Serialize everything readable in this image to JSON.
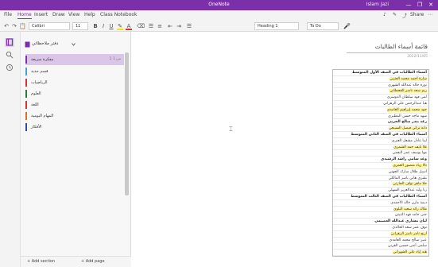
{
  "titlebar": {
    "title": "OneNote",
    "user": "Islam Jazi",
    "controls": [
      "—",
      "❐",
      "✕"
    ]
  },
  "menu": {
    "tabs": [
      "File",
      "Home",
      "Insert",
      "Draw",
      "View",
      "Help",
      "Class Notebook"
    ],
    "active_index": 1,
    "right_icons": [
      "♪",
      "✎",
      "⤴",
      "Share",
      "⋯"
    ]
  },
  "ribbon": {
    "undo": "↶",
    "redo": "↷",
    "clipboard": "📋",
    "font_name": "Calibri",
    "font_size": "11",
    "bold": "B",
    "italic": "I",
    "underline": "U",
    "highlight": "✎",
    "font_color": "A",
    "eraser": "⌫",
    "bullets": "☰",
    "numbering": "≡",
    "outdent": "⇤",
    "indent": "⇥",
    "align": "☰",
    "style_value": "Heading 1",
    "tag_value": "To Do",
    "dictate": "🎤",
    "colors": {
      "highlight": "#f4e500",
      "font": "#d13438",
      "accent": "#7b2fa8"
    }
  },
  "nav": {
    "icons": [
      "notebooks-icon",
      "search-icon",
      "recent-icon"
    ]
  },
  "notebook": {
    "name": "دفتر ملاحظاتي",
    "sections": [
      {
        "label": "مفكرة سريعة",
        "count": "1 من 1",
        "color": "#7b2fa8"
      },
      {
        "label": "قسم جديد",
        "count": "",
        "color": "#4a9fd5"
      },
      {
        "label": "الرياضيات",
        "count": "",
        "color": "#d13438"
      },
      {
        "label": "العلوم",
        "count": "",
        "color": "#2a7a3b"
      },
      {
        "label": "اللغة",
        "count": "",
        "color": "#d13438"
      },
      {
        "label": "المهام اليومية",
        "count": "",
        "color": "#e06c2a"
      },
      {
        "label": "الأفكار",
        "count": "",
        "color": "#2f4f9e"
      }
    ],
    "footer": {
      "add_section": "+ Add section",
      "add_page": "+ Add page"
    }
  },
  "page": {
    "title": "قائمة أسماء الطالبات",
    "date": "2022/11/05",
    "items": [
      {
        "text": "أسماء الطالبات في الصف الأول المتوسط",
        "style": "strong"
      },
      {
        "text": "سارة أحمد محمد العتيبي",
        "style": "hl"
      },
      {
        "text": "نورة خالد عبدالله الشهري",
        "style": ""
      },
      {
        "text": "ريم سعد ناصر القحطاني",
        "style": "hl"
      },
      {
        "text": "لمى فهد سلطان الدوسري",
        "style": ""
      },
      {
        "text": "هيا عبدالرحمن علي الزهراني",
        "style": ""
      },
      {
        "text": "جود محمد إبراهيم الغامدي",
        "style": "hl"
      },
      {
        "text": "شهد ماجد حسن المطيري",
        "style": ""
      },
      {
        "text": "رغد بندر صالح الحربي",
        "style": "strong"
      },
      {
        "text": "دانة تركي فيصل السبيعي",
        "style": "hl"
      },
      {
        "text": "أسماء الطالبات في الصف الثاني المتوسط",
        "style": "strong"
      },
      {
        "text": "لينا عادل مشعل العنزي",
        "style": ""
      },
      {
        "text": "غلا نايف حمد الشمري",
        "style": "hl"
      },
      {
        "text": "مها يوسف عمر البقمي",
        "style": ""
      },
      {
        "text": "وعد سامي راشد الرشيدي",
        "style": "strong"
      },
      {
        "text": "تالا زياد منصور العمري",
        "style": "hl"
      },
      {
        "text": "أسيل طلال مبارك الجهني",
        "style": ""
      },
      {
        "text": "بشرى هاني ياسر المالكي",
        "style": ""
      },
      {
        "text": "حلا ماهر نواف الحارثي",
        "style": "hl"
      },
      {
        "text": "رنا وليد عبدالعزيز السهلي",
        "style": ""
      },
      {
        "text": "أسماء الطالبات في الصف الثالث المتوسط",
        "style": "strong"
      },
      {
        "text": "ديمة مازن خالد الأحمدي",
        "style": ""
      },
      {
        "text": "ملاك رائد سعيد البلوي",
        "style": "hl"
      },
      {
        "text": "جنى حامد فهد الثبيتي",
        "style": ""
      },
      {
        "text": "ليان مشاري عبدالله العصيمي",
        "style": "strong"
      },
      {
        "text": "نوف عمر سعد الخالدي",
        "style": ""
      },
      {
        "text": "أريج ثامر ناصر الزهراني",
        "style": "hl"
      },
      {
        "text": "عبير صالح محمد الغامدي",
        "style": ""
      },
      {
        "text": "سلمى أنس حسين القرني",
        "style": ""
      },
      {
        "text": "هند إياد علي الشهراني",
        "style": "hl"
      }
    ]
  }
}
